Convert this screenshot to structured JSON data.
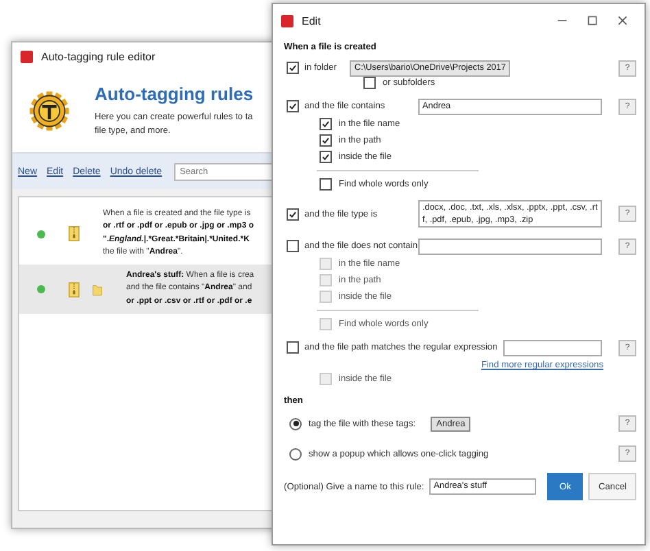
{
  "back_window": {
    "title": "Auto-tagging rule editor",
    "header": {
      "title": "Auto-tagging rules",
      "description": "Here you can create powerful rules to ta",
      "description_2": "file type, and more."
    },
    "toolbar": {
      "links": [
        "New",
        "Edit",
        "Delete",
        "Undo delete"
      ],
      "search": {
        "placeholder": "Search"
      }
    },
    "rules": [
      {
        "selected": false,
        "enabled": true,
        "icons": [
          {
            "kind": "archive"
          }
        ],
        "lines": [
          "When a file is created  and the file type is",
          "**or .rtf or .pdf or .epub or .jpg or .mp3 o**",
          "**\".*England.*|.*Great.*Britain|.*United.*K**",
          "the file with  \"**Andrea**\"."
        ]
      },
      {
        "selected": true,
        "enabled": true,
        "icons": [
          {
            "kind": "archive"
          },
          {
            "kind": "folder"
          }
        ],
        "lines": [
          "**Andrea's stuff:** When a file is crea",
          "and the file contains \"**Andrea**\" and",
          "**or .ppt or .csv or .rtf or .pdf or .e**"
        ]
      }
    ]
  },
  "dialog": {
    "title": "Edit",
    "section_title": "When a file is created",
    "conditions": [
      {
        "kind": "folder",
        "checked": true,
        "label": "in folder",
        "value": "C:\\Users\\bario\\OneDrive\\Projects 2017",
        "help": "?",
        "suboptions": [
          {
            "label": "or subfolders",
            "checked": false,
            "disabled": false
          }
        ]
      },
      {
        "kind": "text",
        "checked": true,
        "label": "and the file contains",
        "value": "Andrea",
        "help": "?",
        "suboptions": [
          {
            "label": "in the file name",
            "checked": true,
            "disabled": false
          },
          {
            "label": "in the path",
            "checked": true,
            "disabled": false
          },
          {
            "label": "inside the file",
            "checked": true,
            "disabled": false
          }
        ],
        "whole_words": {
          "label": "Find whole words only",
          "checked": false,
          "disabled": false
        }
      },
      {
        "kind": "multiline",
        "checked": true,
        "label": "and the file type is",
        "value": ".docx, .doc, .txt, .xls, .xlsx, .pptx, .ppt, .csv, .rtf, .pdf, .epub, .jpg, .mp3, .zip",
        "help": "?"
      },
      {
        "kind": "text",
        "checked": false,
        "label": "and the file does not contain",
        "field": true,
        "help": "?",
        "suboptions": [
          {
            "label": "in the file name",
            "checked": false,
            "disabled": true
          },
          {
            "label": "in the path",
            "checked": false,
            "disabled": true
          },
          {
            "label": "inside the file",
            "checked": false,
            "disabled": true
          }
        ],
        "whole_words": {
          "label": "Find whole words only",
          "checked": false,
          "disabled": true
        }
      },
      {
        "kind": "regex",
        "checked": false,
        "label": "and the file path matches the regular expression",
        "field": true,
        "help": "?",
        "link": "Find more regular expressions",
        "suboptions": [
          {
            "label": "inside the file",
            "checked": false,
            "disabled": true
          }
        ]
      }
    ],
    "then_label": "then",
    "actions": [
      {
        "label": "tag the file with these tags:",
        "selected": true,
        "tags": [
          "Andrea"
        ],
        "help": "?"
      },
      {
        "label": "show a popup which allows one-click tagging",
        "selected": false,
        "help": "?"
      }
    ],
    "name_row": {
      "label": "(Optional) Give a name to this rule:",
      "value": "Andrea's stuff"
    },
    "buttons": [
      {
        "label": "Ok",
        "kind": "primary"
      },
      {
        "label": "Cancel",
        "kind": "secondary"
      }
    ]
  }
}
